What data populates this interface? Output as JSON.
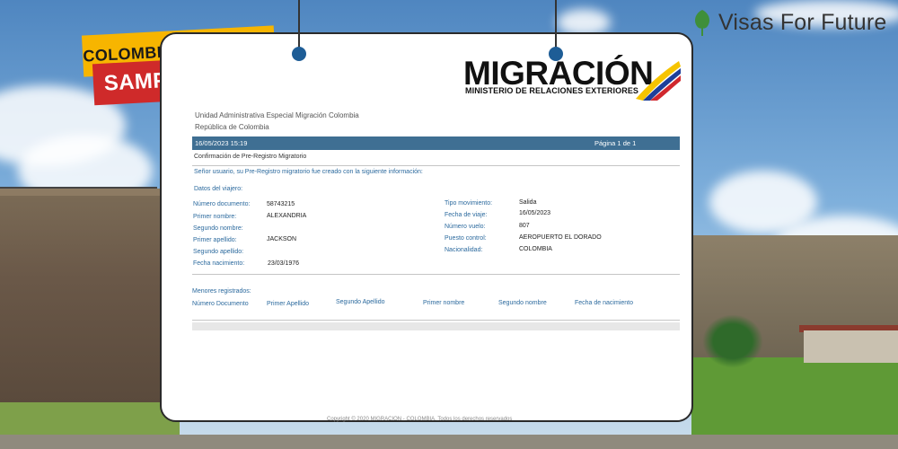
{
  "brand": {
    "name": "Visas For Future",
    "icon": "leaf-icon",
    "color": "#333333",
    "leaf_color": "#3f8f3a"
  },
  "badge": {
    "title": "COLOMBIA CHECK-MIG",
    "label": "SAMPLE",
    "title_color": "#f7b500",
    "label_color": "#cf2a2a"
  },
  "logo": {
    "word": "MIGRACIÓN",
    "subtitle": "MINISTERIO DE RELACIONES EXTERIORES"
  },
  "header": {
    "institution": "Unidad Administrativa Especial Migración Colombia",
    "country": "República de Colombia",
    "datetime": "16/05/2023 15:19",
    "page": "Página 1 de 1",
    "bar_color": "#3f6f93"
  },
  "document": {
    "title": "Confirmación de Pre-Registro Migratorio",
    "message": "Señor usuario, su Pre-Registro migratorio fue creado con la siguiente información:",
    "traveler_section": "Datos del viajero:",
    "traveler": [
      {
        "label": "Número documento:",
        "value": "58743215"
      },
      {
        "label": "Primer nombre:",
        "value": "ALEXANDRIA"
      },
      {
        "label": "Segundo nombre:",
        "value": ""
      },
      {
        "label": "Primer apellido:",
        "value": "JACKSON"
      },
      {
        "label": "Segundo apellido:",
        "value": ""
      },
      {
        "label": "Fecha nacimiento:",
        "value": "23/03/1976"
      }
    ],
    "trip": [
      {
        "label": "Tipo movimiento:",
        "value": "Salida"
      },
      {
        "label": "Fecha de viaje:",
        "value": "16/05/2023"
      },
      {
        "label": "Número vuelo:",
        "value": "807"
      },
      {
        "label": "Puesto control:",
        "value": "AEROPUERTO EL DORADO"
      },
      {
        "label": "Nacionalidad:",
        "value": "COLOMBIA"
      }
    ],
    "minors_section": "Menores registrados:",
    "minors_columns": [
      "Número Documento",
      "Primer Apellido",
      "Segundo Apellido",
      "Primer nombre",
      "Segundo nombre",
      "Fecha de nacimiento"
    ],
    "footer": "Copyright © 2020 MIGRACION - COLOMBIA. Todos los derechos reservados"
  }
}
